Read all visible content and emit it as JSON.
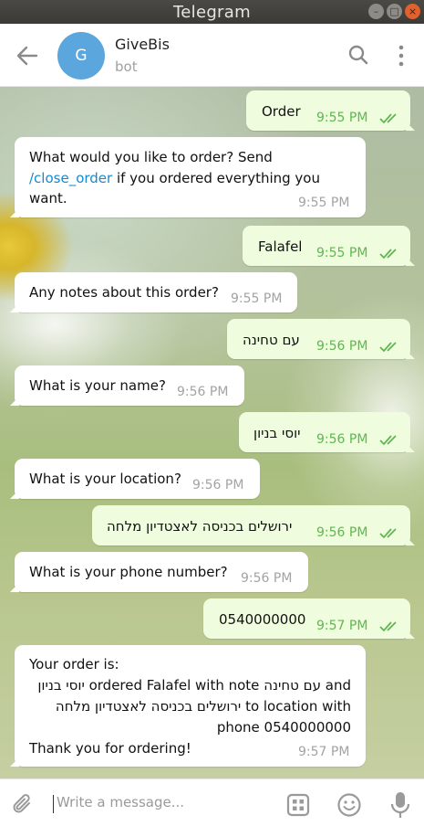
{
  "window": {
    "title": "Telegram"
  },
  "header": {
    "avatar_letter": "G",
    "chat_name": "GiveBis",
    "status": "bot"
  },
  "messages": [
    {
      "dir": "out",
      "text": "Order",
      "time": "9:55 PM"
    },
    {
      "dir": "in",
      "text_parts": [
        "What would you like to order? Send",
        "/close_order",
        " if you ordered everything you",
        "want."
      ],
      "time": "9:55 PM"
    },
    {
      "dir": "out",
      "text": "Falafel",
      "time": "9:55 PM"
    },
    {
      "dir": "in",
      "text": "Any notes about this order?",
      "time": "9:55 PM"
    },
    {
      "dir": "out",
      "text": "עם טחינה",
      "time": "9:56 PM"
    },
    {
      "dir": "in",
      "text": "What is your name?",
      "time": "9:56 PM"
    },
    {
      "dir": "out",
      "text": "יוסי בניון",
      "time": "9:56 PM"
    },
    {
      "dir": "in",
      "text": "What is your location?",
      "time": "9:56 PM"
    },
    {
      "dir": "out",
      "text": "ירושלים בכניסה לאצטדיון מלחה",
      "time": "9:56 PM"
    },
    {
      "dir": "in",
      "text": "What is your phone number?",
      "time": "9:56 PM"
    },
    {
      "dir": "out",
      "text": "0540000000",
      "time": "9:57 PM"
    },
    {
      "dir": "in",
      "lines": [
        "Your order is:",
        "יוסי בניון ordered Falafel with note עם טחינה and",
        "ירושלים בכניסה לאצטדיון מלחה to location with",
        "phone 0540000000",
        "Thank you for ordering!"
      ],
      "time": "9:57 PM"
    }
  ],
  "compose": {
    "placeholder": "Write a message..."
  },
  "colors": {
    "accent": "#168acd",
    "out_bubble": "#effdde",
    "in_bubble": "#ffffff",
    "check": "#5fb74f",
    "avatar": "#5aa6dd"
  },
  "icons": [
    "back-arrow-icon",
    "search-icon",
    "more-vertical-icon",
    "paperclip-icon",
    "bot-commands-icon",
    "emoji-icon",
    "microphone-icon",
    "double-check-icon"
  ]
}
